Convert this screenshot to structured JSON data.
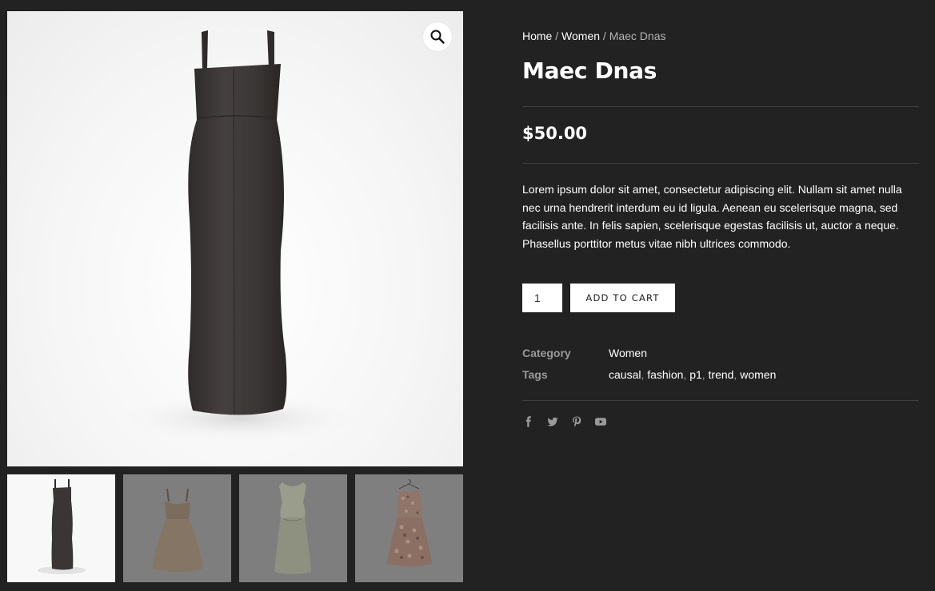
{
  "breadcrumb": {
    "home": "Home",
    "separator": "/",
    "category": "Women",
    "current": "Maec Dnas"
  },
  "product": {
    "title": "Maec Dnas",
    "price": "$50.00",
    "description": "Lorem ipsum dolor sit amet, consectetur adipiscing elit. Nullam sit amet nulla nec urna hendrerit interdum eu id ligula. Aenean eu scelerisque magna, sed facilisis ante. In felis sapien, scelerisque egestas facilisis ut, auctor a neque. Phasellus porttitor metus vitae nibh ultrices commodo."
  },
  "cart": {
    "quantity": "1",
    "button_label": "ADD TO CART"
  },
  "meta": {
    "category_label": "Category",
    "category_value": "Women",
    "tags_label": "Tags",
    "tags": [
      "causal",
      "fashion",
      "p1",
      "trend",
      "women"
    ],
    "tag_separator": ","
  },
  "gallery": {
    "zoom_icon": "magnifier-icon",
    "thumbnails": [
      "black-strap-dress",
      "beige-strap-dress",
      "sage-sleeveless-dress",
      "floral-dress-on-hanger"
    ]
  },
  "social": [
    "facebook-icon",
    "twitter-icon",
    "pinterest-icon",
    "youtube-icon"
  ],
  "colors": {
    "background": "#222222",
    "text": "#ffffff",
    "muted": "#9a9a9a",
    "divider": "#3f3f3f",
    "button_bg": "#ffffff",
    "dress_main": "#3c3837"
  }
}
